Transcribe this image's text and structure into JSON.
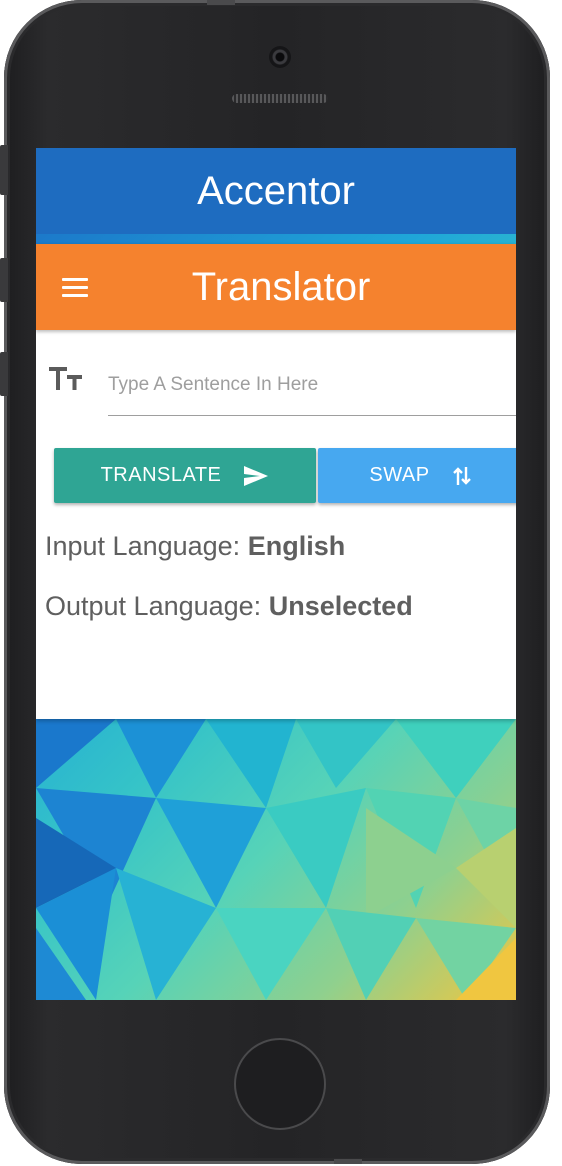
{
  "app": {
    "title": "Accentor"
  },
  "toolbar": {
    "title": "Translator",
    "menu_icon": "hamburger-menu-icon"
  },
  "input": {
    "placeholder": "Type A Sentence In Here",
    "value": "",
    "icon": "text-size-icon"
  },
  "buttons": {
    "translate_label": "TRANSLATE",
    "translate_icon": "send-icon",
    "swap_label": "SWAP",
    "swap_icon": "swap-vertical-icon"
  },
  "languages": {
    "input_label": "Input Language:",
    "input_value": "English",
    "output_label": "Output Language:",
    "output_value": "Unselected"
  },
  "colors": {
    "header": "#1e6cc0",
    "toolbar": "#f5822e",
    "translate_button": "#2fa594",
    "swap_button": "#47a8f0"
  }
}
